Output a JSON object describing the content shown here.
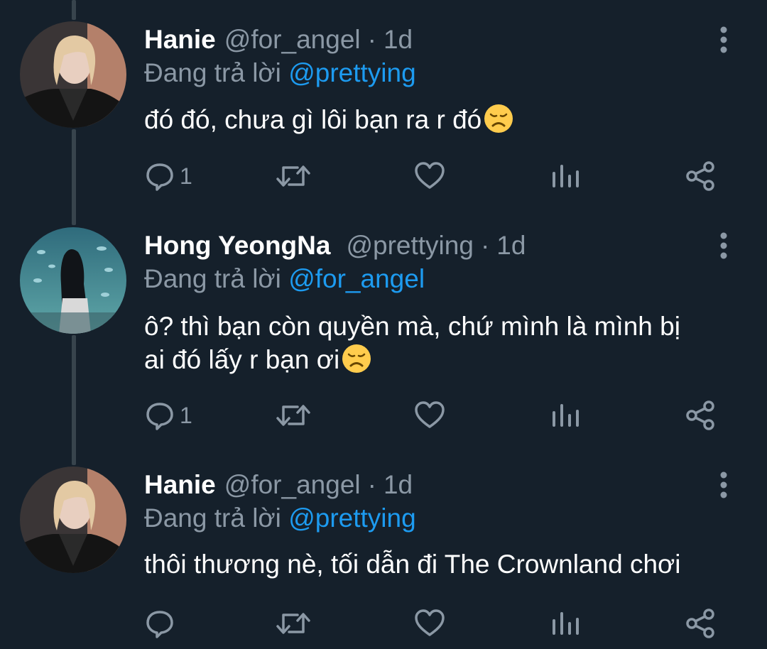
{
  "colors": {
    "background": "#15202b",
    "thread_line": "#38444d",
    "secondary_text": "#8b98a5",
    "mention": "#1d9bf0",
    "primary_text": "#ffffff"
  },
  "tweets": [
    {
      "name": "Hanie",
      "handle": "@for_angel",
      "dot": "·",
      "time": "1d",
      "reply_prefix": "Đang trả lời",
      "reply_to": "@prettying",
      "text_lines": [
        "đó đó, chưa gì lôi bạn ra r đó"
      ],
      "emoji": "disappointed-face",
      "reply_count": "1",
      "avatar_icon": "avatar-blonde-person"
    },
    {
      "name": "Hong YeongNa",
      "handle": "@prettying",
      "dot": "·",
      "time": "1d",
      "reply_prefix": "Đang trả lời",
      "reply_to": "@for_angel",
      "text_lines": [
        "ô? thì bạn còn quyền mà, chứ mình là mình bị",
        "ai đó lấy r bạn ơi"
      ],
      "emoji": "disappointed-face",
      "reply_count": "1",
      "avatar_icon": "avatar-aquarium-person"
    },
    {
      "name": "Hanie",
      "handle": "@for_angel",
      "dot": "·",
      "time": "1d",
      "reply_prefix": "Đang trả lời",
      "reply_to": "@prettying",
      "text_lines": [
        "thôi thương nè, tối dẫn đi The Crownland chơi"
      ],
      "emoji": "",
      "reply_count": "",
      "avatar_icon": "avatar-blonde-person"
    }
  ],
  "action_icons": [
    "reply-icon",
    "retweet-icon",
    "like-icon",
    "analytics-icon",
    "share-icon"
  ]
}
